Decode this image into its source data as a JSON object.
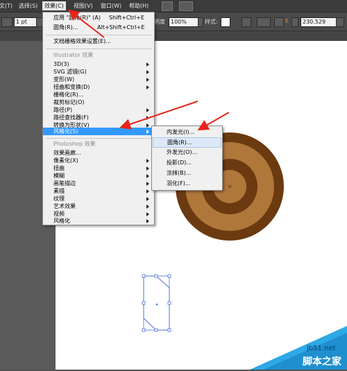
{
  "menubar": {
    "items": [
      {
        "label": "文(T)"
      },
      {
        "label": "选择(S)"
      },
      {
        "label": "效果(C)"
      },
      {
        "label": "视图(V)"
      },
      {
        "label": "窗口(W)"
      },
      {
        "label": "帮助(H)"
      }
    ]
  },
  "controlbar": {
    "stroke_weight": "1 pt",
    "opacity_label": "明度",
    "opacity_value": "100%",
    "style_label": "样式:",
    "x_value": "230.529"
  },
  "effect_menu": {
    "apply_label": "应用 \"圆角(R)\"  (A)",
    "apply_shortcut": "Shift+Ctrl+E",
    "round_corners_label": "圆角(R)...",
    "round_corners_shortcut": "Alt+Shift+Ctrl+E",
    "doc_raster_label": "文档栅格效果设置(E)...",
    "illustrator_header": "Illustrator 效果",
    "illustrator_items": [
      {
        "label": "3D(3)"
      },
      {
        "label": "SVG 滤镜(G)"
      },
      {
        "label": "变形(W)"
      },
      {
        "label": "扭曲和变换(D)"
      },
      {
        "label": "栅格化(R)..."
      },
      {
        "label": "裁剪标记(O)"
      },
      {
        "label": "路径(P)"
      },
      {
        "label": "路径查找器(F)"
      },
      {
        "label": "转换为形状(V)"
      },
      {
        "label": "风格化(S)"
      }
    ],
    "photoshop_header": "Photoshop 效果",
    "photoshop_items": [
      {
        "label": "效果画廊..."
      },
      {
        "label": "像素化(X)"
      },
      {
        "label": "扭曲"
      },
      {
        "label": "模糊"
      },
      {
        "label": "画笔描边"
      },
      {
        "label": "素描"
      },
      {
        "label": "纹理"
      },
      {
        "label": "艺术效果"
      },
      {
        "label": "视频"
      },
      {
        "label": "风格化"
      }
    ]
  },
  "stylize_submenu": {
    "items": [
      {
        "label": "内发光(I)..."
      },
      {
        "label": "圆角(R)..."
      },
      {
        "label": "外发光(O)..."
      },
      {
        "label": "投影(D)..."
      },
      {
        "label": "涂抹(B)..."
      },
      {
        "label": "羽化(F)..."
      }
    ]
  },
  "watermark": {
    "site": "jb51.net",
    "name": "脚本之家"
  },
  "colors": {
    "menu_highlight": "#3399ff",
    "annotation_arrow": "#e8231c",
    "ring_dark": "#6b3a10",
    "ring_light": "#b0773a",
    "selection": "#4a6fd8"
  }
}
